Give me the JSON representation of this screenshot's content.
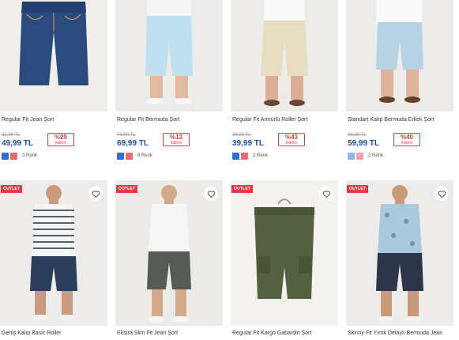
{
  "products_top": [
    {
      "name": "Regular Fit Jean Şort",
      "old_price": "69,99 TL",
      "price": "49,99 TL",
      "discount": "%29",
      "discount_label": "İndirim",
      "colors": "3 Renk"
    },
    {
      "name": "Regular Fit Bermuda Şort",
      "old_price": "79,99 TL",
      "price": "69,99 TL",
      "discount": "%13",
      "discount_label": "İndirim",
      "colors": "8 Renk"
    },
    {
      "name": "Regular Fit Armürlü Roller Şort",
      "old_price": "69,99 TL",
      "price": "39,99 TL",
      "discount": "%43",
      "discount_label": "İndirim",
      "colors": "2 Renk"
    },
    {
      "name": "Standart Kalıp Bermuda Erkek Şort",
      "old_price": "99,99 TL",
      "price": "59,99 TL",
      "discount": "%40",
      "discount_label": "İndirim",
      "colors": "2 Renk"
    }
  ],
  "products_bottom": [
    {
      "badge": "OUTLET",
      "name": "Geniş Kalıp Basic Roller"
    },
    {
      "badge": "OUTLET",
      "name": "Ekstra Slim Fit Jean Şort"
    },
    {
      "badge": "OUTLET",
      "name": "Regular Fit Kargo Gabardin Şort"
    },
    {
      "badge": "OUTLET",
      "name": "Skinny Fit Yırtık Detaylı Bermuda Jean"
    }
  ],
  "colors": {
    "price": "#1a4fa8",
    "discount": "#e03a45",
    "outlet": "#e03a45",
    "image_bg": "#eceae7"
  },
  "icons": {
    "favorite": "heart-icon"
  }
}
